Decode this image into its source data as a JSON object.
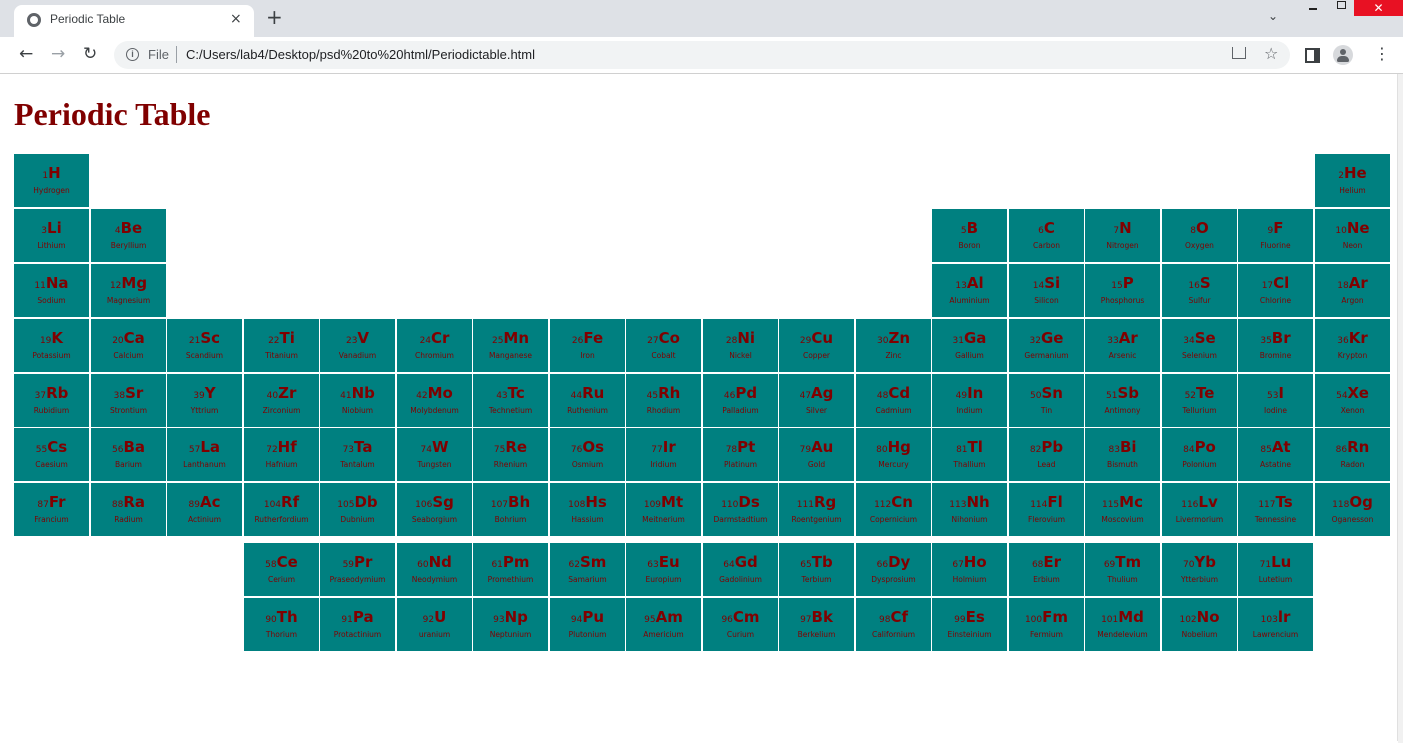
{
  "browser": {
    "tab_title": "Periodic Table",
    "tab_close": "×",
    "new_tab": "+",
    "scheme_label": "File",
    "url": "C:/Users/lab4/Desktop/psd%20to%20html/Periodictable.html",
    "info_glyph": "i",
    "back_glyph": "←",
    "forward_glyph": "→",
    "reload_glyph": "↻",
    "star_glyph": "☆",
    "menu_glyph": "⋮",
    "tab_search_glyph": "⌄",
    "close_glyph": "✕"
  },
  "page": {
    "title": "Periodic Table"
  },
  "colors": {
    "cell_background": "#008080",
    "cell_text": "#800000",
    "title": "#800000"
  },
  "elements": [
    {
      "number": "1",
      "symbol": "H",
      "name": "Hydrogen",
      "row": 1,
      "col": 1
    },
    {
      "number": "2",
      "symbol": "He",
      "name": "Helium",
      "row": 1,
      "col": 18
    },
    {
      "number": "3",
      "symbol": "Li",
      "name": "Lithium",
      "row": 2,
      "col": 1
    },
    {
      "number": "4",
      "symbol": "Be",
      "name": "Beryllium",
      "row": 2,
      "col": 2
    },
    {
      "number": "5",
      "symbol": "B",
      "name": "Boron",
      "row": 2,
      "col": 13
    },
    {
      "number": "6",
      "symbol": "C",
      "name": "Carbon",
      "row": 2,
      "col": 14
    },
    {
      "number": "7",
      "symbol": "N",
      "name": "Nitrogen",
      "row": 2,
      "col": 15
    },
    {
      "number": "8",
      "symbol": "O",
      "name": "Oxygen",
      "row": 2,
      "col": 16
    },
    {
      "number": "9",
      "symbol": "F",
      "name": "Fluorine",
      "row": 2,
      "col": 17
    },
    {
      "number": "10",
      "symbol": "Ne",
      "name": "Neon",
      "row": 2,
      "col": 18
    },
    {
      "number": "11",
      "symbol": "Na",
      "name": "Sodium",
      "row": 3,
      "col": 1
    },
    {
      "number": "12",
      "symbol": "Mg",
      "name": "Magnesium",
      "row": 3,
      "col": 2
    },
    {
      "number": "13",
      "symbol": "Al",
      "name": "Aluminium",
      "row": 3,
      "col": 13
    },
    {
      "number": "14",
      "symbol": "Si",
      "name": "Silicon",
      "row": 3,
      "col": 14
    },
    {
      "number": "15",
      "symbol": "P",
      "name": "Phosphorus",
      "row": 3,
      "col": 15
    },
    {
      "number": "16",
      "symbol": "S",
      "name": "Sulfur",
      "row": 3,
      "col": 16
    },
    {
      "number": "17",
      "symbol": "Cl",
      "name": "Chlorine",
      "row": 3,
      "col": 17
    },
    {
      "number": "18",
      "symbol": "Ar",
      "name": "Argon",
      "row": 3,
      "col": 18
    },
    {
      "number": "19",
      "symbol": "K",
      "name": "Potassium",
      "row": 4,
      "col": 1
    },
    {
      "number": "20",
      "symbol": "Ca",
      "name": "Calcium",
      "row": 4,
      "col": 2
    },
    {
      "number": "21",
      "symbol": "Sc",
      "name": "Scandium",
      "row": 4,
      "col": 3
    },
    {
      "number": "22",
      "symbol": "Ti",
      "name": "Titanium",
      "row": 4,
      "col": 4
    },
    {
      "number": "23",
      "symbol": "V",
      "name": "Vanadium",
      "row": 4,
      "col": 5
    },
    {
      "number": "24",
      "symbol": "Cr",
      "name": "Chromium",
      "row": 4,
      "col": 6
    },
    {
      "number": "25",
      "symbol": "Mn",
      "name": "Manganese",
      "row": 4,
      "col": 7
    },
    {
      "number": "26",
      "symbol": "Fe",
      "name": "Iron",
      "row": 4,
      "col": 8
    },
    {
      "number": "27",
      "symbol": "Co",
      "name": "Cobalt",
      "row": 4,
      "col": 9
    },
    {
      "number": "28",
      "symbol": "Ni",
      "name": "Nickel",
      "row": 4,
      "col": 10
    },
    {
      "number": "29",
      "symbol": "Cu",
      "name": "Copper",
      "row": 4,
      "col": 11
    },
    {
      "number": "30",
      "symbol": "Zn",
      "name": "Zinc",
      "row": 4,
      "col": 12
    },
    {
      "number": "31",
      "symbol": "Ga",
      "name": "Gallium",
      "row": 4,
      "col": 13
    },
    {
      "number": "32",
      "symbol": "Ge",
      "name": "Germanium",
      "row": 4,
      "col": 14
    },
    {
      "number": "33",
      "symbol": "Ar",
      "name": "Arsenic",
      "row": 4,
      "col": 15
    },
    {
      "number": "34",
      "symbol": "Se",
      "name": "Selenium",
      "row": 4,
      "col": 16
    },
    {
      "number": "35",
      "symbol": "Br",
      "name": "Bromine",
      "row": 4,
      "col": 17
    },
    {
      "number": "36",
      "symbol": "Kr",
      "name": "Krypton",
      "row": 4,
      "col": 18
    },
    {
      "number": "37",
      "symbol": "Rb",
      "name": "Rubidium",
      "row": 5,
      "col": 1
    },
    {
      "number": "38",
      "symbol": "Sr",
      "name": "Strontium",
      "row": 5,
      "col": 2
    },
    {
      "number": "39",
      "symbol": "Y",
      "name": "Yttrium",
      "row": 5,
      "col": 3
    },
    {
      "number": "40",
      "symbol": "Zr",
      "name": "Zirconium",
      "row": 5,
      "col": 4
    },
    {
      "number": "41",
      "symbol": "Nb",
      "name": "Niobium",
      "row": 5,
      "col": 5
    },
    {
      "number": "42",
      "symbol": "Mo",
      "name": "Molybdenum",
      "row": 5,
      "col": 6
    },
    {
      "number": "43",
      "symbol": "Tc",
      "name": "Technetium",
      "row": 5,
      "col": 7
    },
    {
      "number": "44",
      "symbol": "Ru",
      "name": "Ruthenium",
      "row": 5,
      "col": 8
    },
    {
      "number": "45",
      "symbol": "Rh",
      "name": "Rhodium",
      "row": 5,
      "col": 9
    },
    {
      "number": "46",
      "symbol": "Pd",
      "name": "Palladium",
      "row": 5,
      "col": 10
    },
    {
      "number": "47",
      "symbol": "Ag",
      "name": "Silver",
      "row": 5,
      "col": 11
    },
    {
      "number": "48",
      "symbol": "Cd",
      "name": "Cadmium",
      "row": 5,
      "col": 12
    },
    {
      "number": "49",
      "symbol": "In",
      "name": "Indium",
      "row": 5,
      "col": 13
    },
    {
      "number": "50",
      "symbol": "Sn",
      "name": "Tin",
      "row": 5,
      "col": 14
    },
    {
      "number": "51",
      "symbol": "Sb",
      "name": "Antimony",
      "row": 5,
      "col": 15
    },
    {
      "number": "52",
      "symbol": "Te",
      "name": "Tellurium",
      "row": 5,
      "col": 16
    },
    {
      "number": "53",
      "symbol": "I",
      "name": "Iodine",
      "row": 5,
      "col": 17
    },
    {
      "number": "54",
      "symbol": "Xe",
      "name": "Xenon",
      "row": 5,
      "col": 18
    },
    {
      "number": "55",
      "symbol": "Cs",
      "name": "Caesium",
      "row": 6,
      "col": 1
    },
    {
      "number": "56",
      "symbol": "Ba",
      "name": "Barium",
      "row": 6,
      "col": 2
    },
    {
      "number": "57",
      "symbol": "La",
      "name": "Lanthanum",
      "row": 6,
      "col": 3
    },
    {
      "number": "72",
      "symbol": "Hf",
      "name": "Hafnium",
      "row": 6,
      "col": 4
    },
    {
      "number": "73",
      "symbol": "Ta",
      "name": "Tantalum",
      "row": 6,
      "col": 5
    },
    {
      "number": "74",
      "symbol": "W",
      "name": "Tungsten",
      "row": 6,
      "col": 6
    },
    {
      "number": "75",
      "symbol": "Re",
      "name": "Rhenium",
      "row": 6,
      "col": 7
    },
    {
      "number": "76",
      "symbol": "Os",
      "name": "Osmium",
      "row": 6,
      "col": 8
    },
    {
      "number": "77",
      "symbol": "Ir",
      "name": "Iridium",
      "row": 6,
      "col": 9
    },
    {
      "number": "78",
      "symbol": "Pt",
      "name": "Platinum",
      "row": 6,
      "col": 10
    },
    {
      "number": "79",
      "symbol": "Au",
      "name": "Gold",
      "row": 6,
      "col": 11
    },
    {
      "number": "80",
      "symbol": "Hg",
      "name": "Mercury",
      "row": 6,
      "col": 12
    },
    {
      "number": "81",
      "symbol": "Tl",
      "name": "Thallium",
      "row": 6,
      "col": 13
    },
    {
      "number": "82",
      "symbol": "Pb",
      "name": "Lead",
      "row": 6,
      "col": 14
    },
    {
      "number": "83",
      "symbol": "Bi",
      "name": "Bismuth",
      "row": 6,
      "col": 15
    },
    {
      "number": "84",
      "symbol": "Po",
      "name": "Polonium",
      "row": 6,
      "col": 16
    },
    {
      "number": "85",
      "symbol": "At",
      "name": "Astatine",
      "row": 6,
      "col": 17
    },
    {
      "number": "86",
      "symbol": "Rn",
      "name": "Radon",
      "row": 6,
      "col": 18
    },
    {
      "number": "87",
      "symbol": "Fr",
      "name": "Francium",
      "row": 7,
      "col": 1
    },
    {
      "number": "88",
      "symbol": "Ra",
      "name": "Radium",
      "row": 7,
      "col": 2
    },
    {
      "number": "89",
      "symbol": "Ac",
      "name": "Actinium",
      "row": 7,
      "col": 3
    },
    {
      "number": "104",
      "symbol": "Rf",
      "name": "Rutherfordium",
      "row": 7,
      "col": 4
    },
    {
      "number": "105",
      "symbol": "Db",
      "name": "Dubnium",
      "row": 7,
      "col": 5
    },
    {
      "number": "106",
      "symbol": "Sg",
      "name": "Seaborgium",
      "row": 7,
      "col": 6
    },
    {
      "number": "107",
      "symbol": "Bh",
      "name": "Bohrium",
      "row": 7,
      "col": 7
    },
    {
      "number": "108",
      "symbol": "Hs",
      "name": "Hassium",
      "row": 7,
      "col": 8
    },
    {
      "number": "109",
      "symbol": "Mt",
      "name": "Meitnerium",
      "row": 7,
      "col": 9
    },
    {
      "number": "110",
      "symbol": "Ds",
      "name": "Darmstadtium",
      "row": 7,
      "col": 10
    },
    {
      "number": "111",
      "symbol": "Rg",
      "name": "Roentgenium",
      "row": 7,
      "col": 11
    },
    {
      "number": "112",
      "symbol": "Cn",
      "name": "Copernicium",
      "row": 7,
      "col": 12
    },
    {
      "number": "113",
      "symbol": "Nh",
      "name": "Nihonium",
      "row": 7,
      "col": 13
    },
    {
      "number": "114",
      "symbol": "Fl",
      "name": "Flerovium",
      "row": 7,
      "col": 14
    },
    {
      "number": "115",
      "symbol": "Mc",
      "name": "Moscovium",
      "row": 7,
      "col": 15
    },
    {
      "number": "116",
      "symbol": "Lv",
      "name": "Livermorium",
      "row": 7,
      "col": 16
    },
    {
      "number": "117",
      "symbol": "Ts",
      "name": "Tennessine",
      "row": 7,
      "col": 17
    },
    {
      "number": "118",
      "symbol": "Og",
      "name": "Oganesson",
      "row": 7,
      "col": 18
    },
    {
      "number": "58",
      "symbol": "Ce",
      "name": "Cerium",
      "row": 8,
      "col": 4
    },
    {
      "number": "59",
      "symbol": "Pr",
      "name": "Praseodymium",
      "row": 8,
      "col": 5
    },
    {
      "number": "60",
      "symbol": "Nd",
      "name": "Neodymium",
      "row": 8,
      "col": 6
    },
    {
      "number": "61",
      "symbol": "Pm",
      "name": "Promethium",
      "row": 8,
      "col": 7
    },
    {
      "number": "62",
      "symbol": "Sm",
      "name": "Samarium",
      "row": 8,
      "col": 8
    },
    {
      "number": "63",
      "symbol": "Eu",
      "name": "Europium",
      "row": 8,
      "col": 9
    },
    {
      "number": "64",
      "symbol": "Gd",
      "name": "Gadolinium",
      "row": 8,
      "col": 10
    },
    {
      "number": "65",
      "symbol": "Tb",
      "name": "Terbium",
      "row": 8,
      "col": 11
    },
    {
      "number": "66",
      "symbol": "Dy",
      "name": "Dysprosium",
      "row": 8,
      "col": 12
    },
    {
      "number": "67",
      "symbol": "Ho",
      "name": "Holmium",
      "row": 8,
      "col": 13
    },
    {
      "number": "68",
      "symbol": "Er",
      "name": "Erbium",
      "row": 8,
      "col": 14
    },
    {
      "number": "69",
      "symbol": "Tm",
      "name": "Thulium",
      "row": 8,
      "col": 15
    },
    {
      "number": "70",
      "symbol": "Yb",
      "name": "Ytterbium",
      "row": 8,
      "col": 16
    },
    {
      "number": "71",
      "symbol": "Lu",
      "name": "Lutetium",
      "row": 8,
      "col": 17
    },
    {
      "number": "90",
      "symbol": "Th",
      "name": "Thorium",
      "row": 9,
      "col": 4
    },
    {
      "number": "91",
      "symbol": "Pa",
      "name": "Protactinium",
      "row": 9,
      "col": 5
    },
    {
      "number": "92",
      "symbol": "U",
      "name": "uranium",
      "row": 9,
      "col": 6
    },
    {
      "number": "93",
      "symbol": "Np",
      "name": "Neptunium",
      "row": 9,
      "col": 7
    },
    {
      "number": "94",
      "symbol": "Pu",
      "name": "Plutonium",
      "row": 9,
      "col": 8
    },
    {
      "number": "95",
      "symbol": "Am",
      "name": "Americium",
      "row": 9,
      "col": 9
    },
    {
      "number": "96",
      "symbol": "Cm",
      "name": "Curium",
      "row": 9,
      "col": 10
    },
    {
      "number": "97",
      "symbol": "Bk",
      "name": "Berkelium",
      "row": 9,
      "col": 11
    },
    {
      "number": "98",
      "symbol": "Cf",
      "name": "Californium",
      "row": 9,
      "col": 12
    },
    {
      "number": "99",
      "symbol": "Es",
      "name": "Einsteinium",
      "row": 9,
      "col": 13
    },
    {
      "number": "100",
      "symbol": "Fm",
      "name": "Fermium",
      "row": 9,
      "col": 14
    },
    {
      "number": "101",
      "symbol": "Md",
      "name": "Mendelevium",
      "row": 9,
      "col": 15
    },
    {
      "number": "102",
      "symbol": "No",
      "name": "Nobelium",
      "row": 9,
      "col": 16
    },
    {
      "number": "103",
      "symbol": "lr",
      "name": "Lawrencium",
      "row": 9,
      "col": 17
    }
  ]
}
